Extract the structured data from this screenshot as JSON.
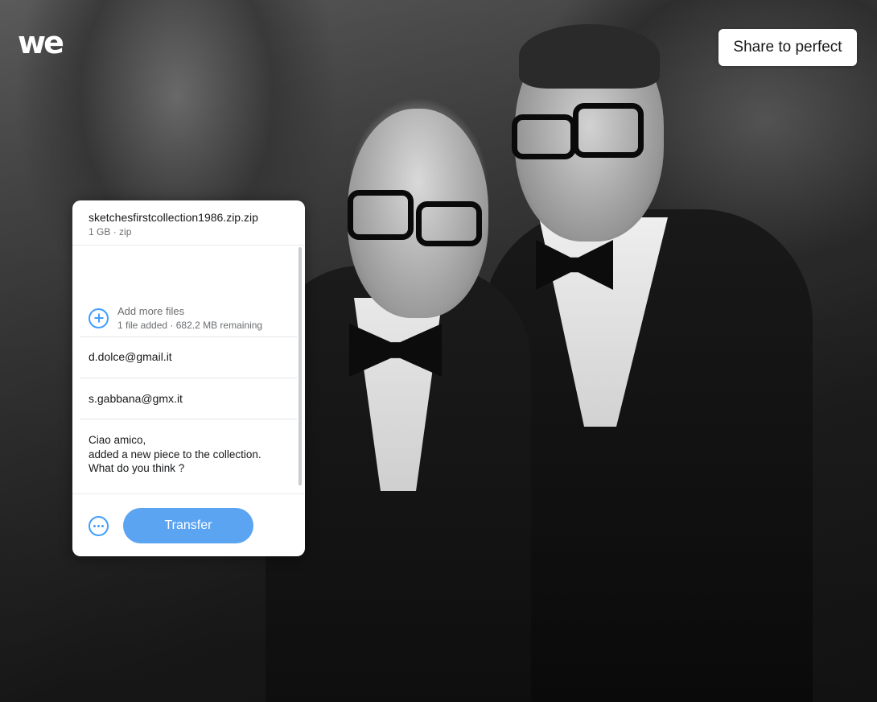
{
  "brand": {
    "logo_text": "we"
  },
  "header": {
    "share_label": "Share to perfect"
  },
  "transfer_panel": {
    "file": {
      "name": "sketchesfirstcollection1986.zip.zip",
      "size": "1 GB",
      "type": "zip"
    },
    "add_more": {
      "label": "Add more files",
      "status": "1 file added · 682.2 MB remaining"
    },
    "email_to": "d.dolce@gmail.it",
    "email_from": "s.gabbana@gmx.it",
    "message": "Ciao amico,\nadded a new piece to the collection.\nWhat do you think ?",
    "transfer_label": "Transfer"
  },
  "colors": {
    "accent": "#409fff",
    "transfer_button": "#5ba4f2"
  },
  "icons": [
    "plus-circle-icon",
    "more-options-icon"
  ]
}
